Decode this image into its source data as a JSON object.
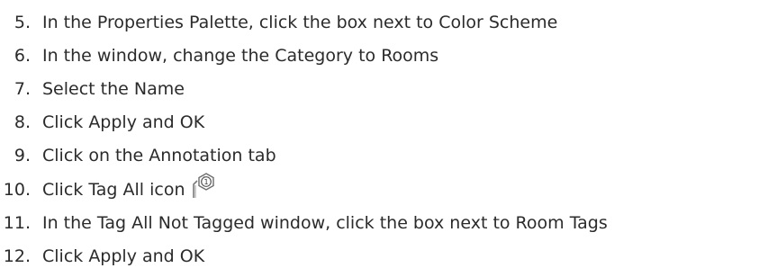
{
  "steps": [
    {
      "number": "5.",
      "text": "In the Properties Palette, click the box next to Color Scheme"
    },
    {
      "number": "6.",
      "text": "In the window, change the Category to Rooms"
    },
    {
      "number": "7.",
      "text": "Select the Name"
    },
    {
      "number": "8.",
      "text": "Click Apply and OK"
    },
    {
      "number": "9.",
      "text": "Click on the Annotation tab"
    },
    {
      "number": "10.",
      "text": "Click Tag All icon",
      "icon": "tag-all-icon",
      "icon_label": "1"
    },
    {
      "number": "11.",
      "text": "In the Tag All Not Tagged window, click the box next to Room Tags"
    },
    {
      "number": "12.",
      "text": "Click Apply and OK"
    }
  ]
}
